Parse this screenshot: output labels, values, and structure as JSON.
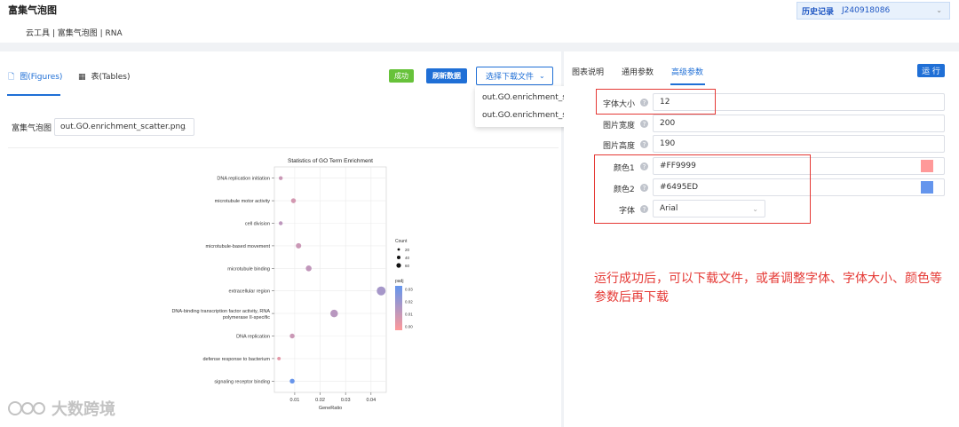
{
  "header": {
    "title": "富集气泡图",
    "breadcrumb": "云工具 | 富集气泡图 | RNA",
    "history_label": "历史记录",
    "history_value": "J240918086"
  },
  "left": {
    "tabs": [
      {
        "label": "图(Figures)"
      },
      {
        "label": "表(Tables)"
      }
    ],
    "success_label": "成功",
    "refresh_label": "刷新数据",
    "download_label": "选择下载文件",
    "dropdown_options": [
      "out.GO.enrichment_scatter.png",
      "out.GO.enrichment_scatter.pdf"
    ],
    "select_label": "富集气泡图",
    "select_value": "out.GO.enrichment_scatter.png"
  },
  "right": {
    "tabs": [
      {
        "label": "图表说明"
      },
      {
        "label": "通用参数"
      },
      {
        "label": "高级参数"
      }
    ],
    "run_label": "运 行",
    "params": [
      {
        "label": "字体大小",
        "value": "12"
      },
      {
        "label": "图片宽度",
        "value": "200"
      },
      {
        "label": "图片高度",
        "value": "190"
      },
      {
        "label": "颜色1",
        "value": "#FF9999"
      },
      {
        "label": "颜色2",
        "value": "#6495ED"
      },
      {
        "label": "字体",
        "value": "Arial"
      }
    ],
    "color1": "#FF9999",
    "color2": "#6495ED",
    "annotation": "运行成功后，可以下载文件，或者调整字体、字体大小、颜色等参数后再下载"
  },
  "watermark": "大数跨境",
  "chart_data": {
    "type": "scatter",
    "title": "Statistics of GO Term Enrichment",
    "xlabel": "GeneRatio",
    "ylabel": "",
    "xlim": [
      0.002,
      0.046
    ],
    "xticks": [
      "0.01",
      "0.02",
      "0.03",
      "0.04"
    ],
    "categories": [
      "DNA replication initiation",
      "microtubule motor activity",
      "cell division",
      "microtubule-based movement",
      "microtubule binding",
      "extracellular region",
      "DNA-binding transcription factor activity, RNA polymerase II-specific",
      "DNA replication",
      "defense response to bacterium",
      "signaling receptor binding"
    ],
    "points": [
      {
        "term": "DNA replication initiation",
        "x": 0.0045,
        "count": 3,
        "padj": 0.012
      },
      {
        "term": "microtubule motor activity",
        "x": 0.0095,
        "count": 6,
        "padj": 0.01
      },
      {
        "term": "cell division",
        "x": 0.0045,
        "count": 3,
        "padj": 0.015
      },
      {
        "term": "microtubule-based movement",
        "x": 0.0115,
        "count": 8,
        "padj": 0.012
      },
      {
        "term": "microtubule binding",
        "x": 0.0155,
        "count": 10,
        "padj": 0.014
      },
      {
        "term": "extracellular region",
        "x": 0.044,
        "count": 30,
        "padj": 0.02
      },
      {
        "term": "DNA-binding transcription factor activity, RNA polymerase II-specific",
        "x": 0.0255,
        "count": 20,
        "padj": 0.016
      },
      {
        "term": "DNA replication",
        "x": 0.009,
        "count": 6,
        "padj": 0.012
      },
      {
        "term": "defense response to bacterium",
        "x": 0.0038,
        "count": 2,
        "padj": 0.006
      },
      {
        "term": "signaling receptor binding",
        "x": 0.009,
        "count": 6,
        "padj": 0.034
      }
    ],
    "size_legend": {
      "title": "Count",
      "values": [
        20,
        40,
        60
      ]
    },
    "color_legend": {
      "title": "padj",
      "ticks": [
        "0.03",
        "0.02",
        "0.01",
        "0.00"
      ],
      "range": [
        0,
        0.035
      ]
    },
    "grid": true
  }
}
